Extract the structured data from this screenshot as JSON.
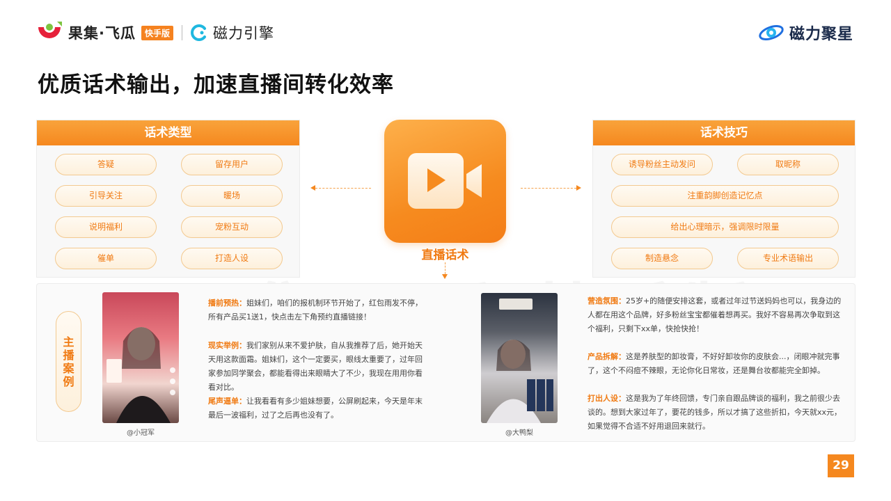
{
  "header": {
    "brand_main": "果集·飞瓜",
    "brand_tag": "快手版",
    "brand_partner": "磁力引擎",
    "brand_right": "磁力聚星"
  },
  "page": {
    "title": "优质话术输出，加速直播间转化效率",
    "number": "29"
  },
  "left_panel": {
    "title": "话术类型",
    "items": [
      "答疑",
      "留存用户",
      "引导关注",
      "暖场",
      "说明福利",
      "宠粉互动",
      "催单",
      "打造人设"
    ]
  },
  "center": {
    "label": "直播话术",
    "icon": "video-camera-icon"
  },
  "right_panel": {
    "title": "话术技巧",
    "items": [
      "诱导粉丝主动发问",
      "取昵称",
      "注重韵脚创造记忆点",
      "给出心理暗示，强调限时限量",
      "制造悬念",
      "专业术语输出"
    ]
  },
  "cases": {
    "tag": "主播案例",
    "left": {
      "handle": "@小冠军",
      "paras": [
        {
          "label": "播前预热：",
          "text": "姐妹们，咱们的报机制环节开始了，红包雨发不停，所有产品买1送1，快点击左下角预约直播链接！"
        },
        {
          "label": "现实举例：",
          "text": "我们家别从来不爱护肤，自从我推荐了后，她开始天天用这款面霜。姐妹们，这个一定要买，眼线太重要了，过年回家参加同学聚会，都能看得出来眼睛大了不少，我现在用用你看看对比。"
        },
        {
          "label": "尾声逼单：",
          "text": "让我看看有多少姐妹想要，公屏刷起来，今天是年末最后一波福利，过了之后再也没有了。"
        }
      ]
    },
    "right": {
      "handle": "@大鸭梨",
      "paras": [
        {
          "label": "营造氛围：",
          "text": "25岁+的随便安排这套，或者过年过节送妈妈也可以，我身边的人都在用这个品牌，好多粉丝宝宝都催着想再买。我好不容易再次争取到这个福利，只剩下xx单，快抢快抢！"
        },
        {
          "label": "产品拆解：",
          "text": "这是养肤型的卸妆膏，不好好卸妆你的皮肤会...，闭眼冲就完事了，这个不闷痘不辣眼，无论你化日常妆，还是舞台妆都能完全卸掉。"
        },
        {
          "label": "打出人设：",
          "text": "这是我为了年终回馈，专门亲自跟品牌谈的福利，我之前很少去谈的。想到大家过年了，要花的钱多，所以才搞了这些折扣，今天就xx元，如果觉得不合适不好用退回来就行。"
        }
      ]
    }
  },
  "colors": {
    "accent": "#f5881f",
    "accent_text": "#f07a12",
    "pill_border": "#f3c98f"
  }
}
